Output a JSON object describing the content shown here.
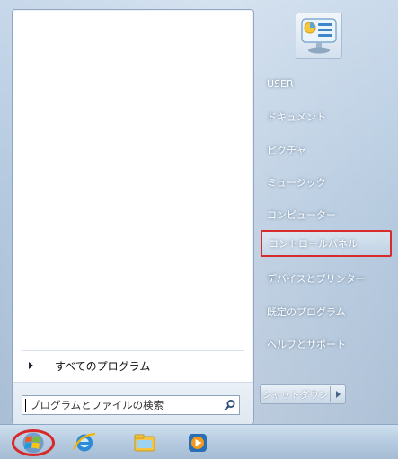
{
  "start_menu": {
    "all_programs_label": "すべてのプログラム",
    "search": {
      "placeholder": "プログラムとファイルの検索"
    },
    "right_items": [
      {
        "label": "USER"
      },
      {
        "label": "ドキュメント"
      },
      {
        "label": "ピクチャ"
      },
      {
        "label": "ミュージック"
      },
      {
        "label": "コンピューター"
      },
      {
        "label": "コントロールパネル",
        "highlighted": true
      },
      {
        "label": "デバイスとプリンター"
      },
      {
        "label": "既定のプログラム"
      },
      {
        "label": "ヘルプとサポート"
      }
    ],
    "shutdown_label": "シャットダウン"
  },
  "taskbar": {
    "icons": [
      "windows-start-icon",
      "internet-explorer-icon",
      "file-explorer-icon",
      "media-player-icon"
    ]
  },
  "colors": {
    "highlight_outline": "#d82b2b",
    "frame_blue": "#b3c8de"
  }
}
